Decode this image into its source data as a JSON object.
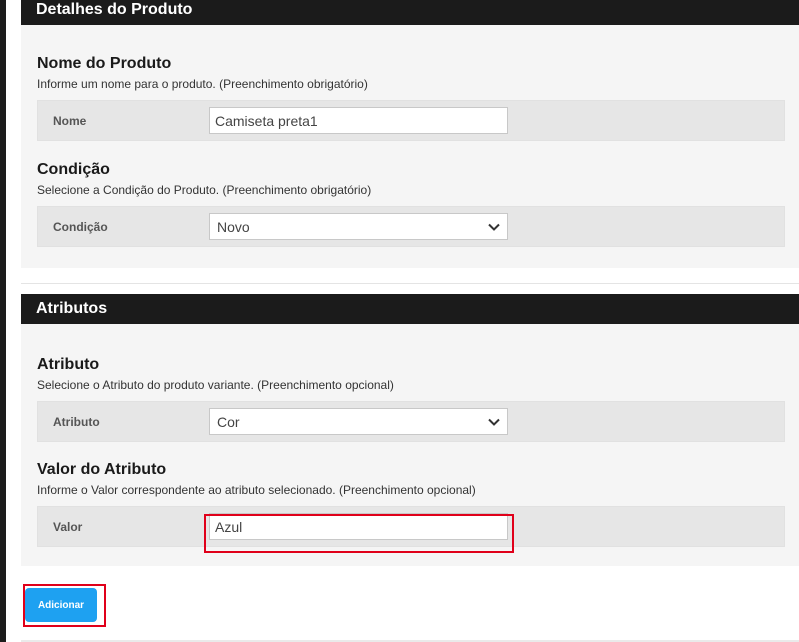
{
  "product_details": {
    "header": "Detalhes do Produto",
    "name_section": {
      "title": "Nome do Produto",
      "description": "Informe um nome para o produto. (Preenchimento obrigatório)",
      "label": "Nome",
      "value": "Camiseta preta1"
    },
    "condition_section": {
      "title": "Condição",
      "description": "Selecione a Condição do Produto. (Preenchimento obrigatório)",
      "label": "Condição",
      "selected": "Novo"
    }
  },
  "attributes": {
    "header": "Atributos",
    "attribute_section": {
      "title": "Atributo",
      "description": "Selecione o Atributo do produto variante. (Preenchimento opcional)",
      "label": "Atributo",
      "selected": "Cor"
    },
    "value_section": {
      "title": "Valor do Atributo",
      "description": "Informe o Valor correspondente ao atributo selecionado. (Preenchimento opcional)",
      "label": "Valor",
      "value": "Azul"
    }
  },
  "actions": {
    "add_label": "Adicionar"
  },
  "colors": {
    "header_bg": "#1b1b1b",
    "panel_bg": "#f5f5f5",
    "button_bg": "#1ea1f1",
    "highlight": "#e0001a"
  },
  "icons": {
    "select_arrow": "chevron-down-icon"
  }
}
